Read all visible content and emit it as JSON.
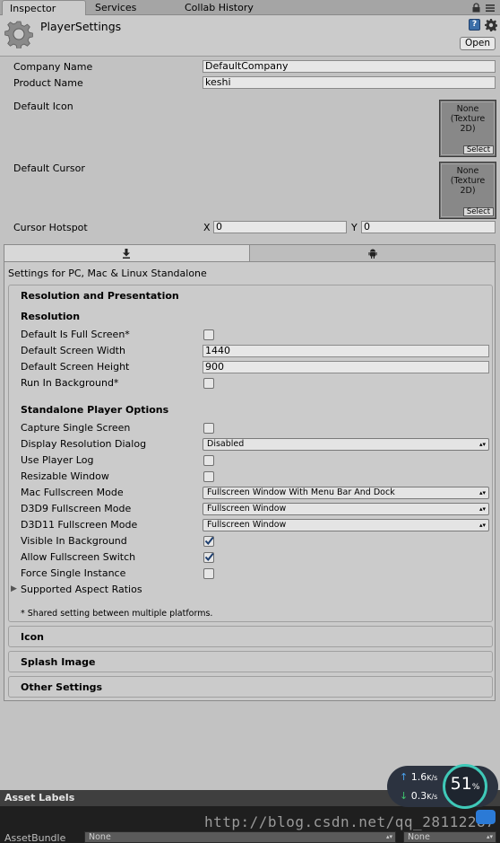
{
  "tabs": [
    "Inspector",
    "Services",
    "Collab History"
  ],
  "header": {
    "title": "PlayerSettings",
    "help_icon": "?",
    "open_label": "Open"
  },
  "company": {
    "label": "Company Name",
    "value": "DefaultCompany"
  },
  "product": {
    "label": "Product Name",
    "value": "keshi"
  },
  "default_icon": {
    "label": "Default Icon",
    "texture": "None\n(Texture\n2D)",
    "select": "Select"
  },
  "default_cursor": {
    "label": "Default Cursor",
    "texture": "None\n(Texture\n2D)",
    "select": "Select"
  },
  "cursor_hotspot": {
    "label": "Cursor Hotspot",
    "x_label": "X",
    "x_value": "0",
    "y_label": "Y",
    "y_value": "0"
  },
  "platform": {
    "settings_for": "Settings for PC, Mac & Linux Standalone",
    "resolution_section": {
      "title": "Resolution and Presentation",
      "resolution_heading": "Resolution",
      "full_screen": {
        "label": "Default Is Full Screen*",
        "checked": false
      },
      "screen_width": {
        "label": "Default Screen Width",
        "value": "1440"
      },
      "screen_height": {
        "label": "Default Screen Height",
        "value": "900"
      },
      "run_in_bg": {
        "label": "Run In Background*",
        "checked": false
      },
      "standalone_heading": "Standalone Player Options",
      "capture_single": {
        "label": "Capture Single Screen",
        "checked": false
      },
      "display_dialog": {
        "label": "Display Resolution Dialog",
        "value": "Disabled"
      },
      "use_player_log": {
        "label": "Use Player Log",
        "checked": false
      },
      "resizable": {
        "label": "Resizable Window",
        "checked": false
      },
      "mac_fullscreen": {
        "label": "Mac Fullscreen Mode",
        "value": "Fullscreen Window With Menu Bar And Dock"
      },
      "d3d9_fullscreen": {
        "label": "D3D9 Fullscreen Mode",
        "value": "Fullscreen Window"
      },
      "d3d11_fullscreen": {
        "label": "D3D11 Fullscreen Mode",
        "value": "Fullscreen Window"
      },
      "visible_in_bg": {
        "label": "Visible In Background",
        "checked": true
      },
      "allow_switch": {
        "label": "Allow Fullscreen Switch",
        "checked": true
      },
      "force_single": {
        "label": "Force Single Instance",
        "checked": false
      },
      "aspect_ratios": "Supported Aspect Ratios",
      "footnote": "* Shared setting between multiple platforms."
    },
    "icon_section": "Icon",
    "splash_section": "Splash Image",
    "other_section": "Other Settings"
  },
  "asset_labels": "Asset Labels",
  "asset_bundle": {
    "label": "AssetBundle",
    "value1": "None",
    "value2": "None"
  },
  "watermark": "http://blog.csdn.net/qq_28112287",
  "network": {
    "up": "1.6",
    "down": "0.3",
    "unit": "K/s",
    "percent": "51",
    "percent_sign": "%"
  },
  "colors": {
    "check_mark": "#1c3d6e",
    "network_ring": "#3fc9b8",
    "net_up_arrow": "#4aa3f0",
    "net_down_arrow": "#3ec46d"
  }
}
